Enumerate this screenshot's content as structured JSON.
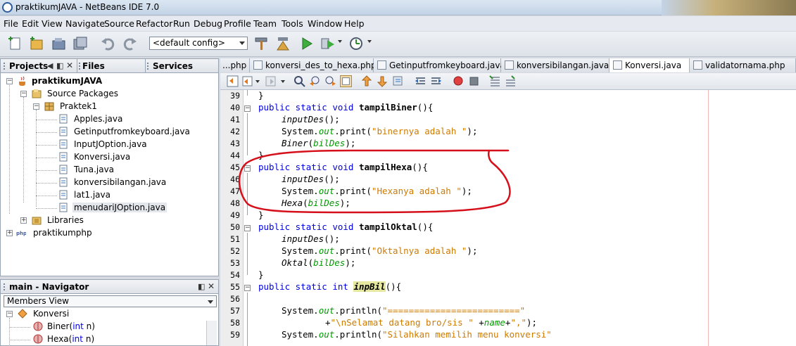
{
  "window": {
    "title": "praktikumJAVA - NetBeans IDE 7.0"
  },
  "menu": [
    "File",
    "Edit",
    "View",
    "Navigate",
    "Source",
    "Refactor",
    "Run",
    "Debug",
    "Profile",
    "Team",
    "Tools",
    "Window",
    "Help"
  ],
  "toolbar": {
    "config": "<default config>"
  },
  "panels": {
    "projects": "Projects",
    "files": "Files",
    "services": "Services"
  },
  "tree": {
    "project": "praktikumJAVA",
    "source_packages": "Source Packages",
    "package": "Praktek1",
    "files": [
      "Apples.java",
      "Getinputfromkeyboard.java",
      "InputJOption.java",
      "Konversi.java",
      "Tuna.java",
      "konversibilangan.java",
      "lat1.java",
      "menudariJOption.java"
    ],
    "libraries": "Libraries",
    "project2": "praktikumphp"
  },
  "navigator": {
    "title": "main - Navigator",
    "view": "Members View",
    "root": "Konversi",
    "members": [
      {
        "name": "Biner",
        "type": "int",
        "param": "n"
      },
      {
        "name": "Hexa",
        "type": "int",
        "param": "n"
      }
    ]
  },
  "editor": {
    "tabs": [
      "...php",
      "konversi_des_to_hexa.php",
      "Getinputfromkeyboard.java",
      "konversibilangan.java",
      "Konversi.java",
      "validatornama.php"
    ],
    "active_tab": "Konversi.java",
    "line_numbers": [
      "39",
      "40",
      "41",
      "42",
      "43",
      "44",
      "45",
      "46",
      "47",
      "48",
      "49",
      "50",
      "51",
      "52",
      "53",
      "54",
      "55",
      "56",
      "57",
      "58",
      "59"
    ],
    "code": {
      "l40": {
        "kw": "public static void ",
        "name": "tampilBiner",
        "rest": "(){"
      },
      "l41": {
        "call": "inputDes",
        "rest": "();"
      },
      "l42": {
        "pre": "System.",
        "fld": "out",
        "mid": ".print(",
        "str": "\"binernya adalah \"",
        "post": ");"
      },
      "l43": {
        "call": "Biner",
        "mid": "(",
        "arg": "bilDes",
        "post": ");"
      },
      "l45": {
        "kw": "public static void ",
        "name": "tampilHexa",
        "rest": "(){"
      },
      "l46": {
        "call": "inputDes",
        "rest": "();"
      },
      "l47": {
        "pre": "System.",
        "fld": "out",
        "mid": ".print(",
        "str": "\"Hexanya adalah \"",
        "post": ");"
      },
      "l48": {
        "call": "Hexa",
        "mid": "(",
        "arg": "bilDes",
        "post": ");"
      },
      "l50": {
        "kw": "public static void ",
        "name": "tampilOktal",
        "rest": "(){"
      },
      "l51": {
        "call": "inputDes",
        "rest": "();"
      },
      "l52": {
        "pre": "System.",
        "fld": "out",
        "mid": ".print(",
        "str": "\"Oktalnya adalah \"",
        "post": ");"
      },
      "l53": {
        "call": "Oktal",
        "mid": "(",
        "arg": "bilDes",
        "post": ");"
      },
      "l55": {
        "kw": "public static int ",
        "name": "inpBil",
        "rest": "(){"
      },
      "l57": {
        "pre": "System.",
        "fld": "out",
        "mid": ".println(",
        "str": "\"=========================\""
      },
      "l58": {
        "pre": "+",
        "str1": "\"\\nSelamat datang bro/sis \"",
        "mid": " +",
        "var": "name",
        "plus": "+",
        "str2": "\",\"",
        "post": ");"
      },
      "l59": {
        "pre": "System.",
        "fld": "out",
        "mid": ".println(",
        "str": "\"Silahkan memilih menu konversi\""
      }
    },
    "brace": "}"
  },
  "colors": {
    "keyword": "#0000e6",
    "string": "#ce7b00",
    "field": "#009900",
    "annotation_circle": "#d6101a"
  }
}
